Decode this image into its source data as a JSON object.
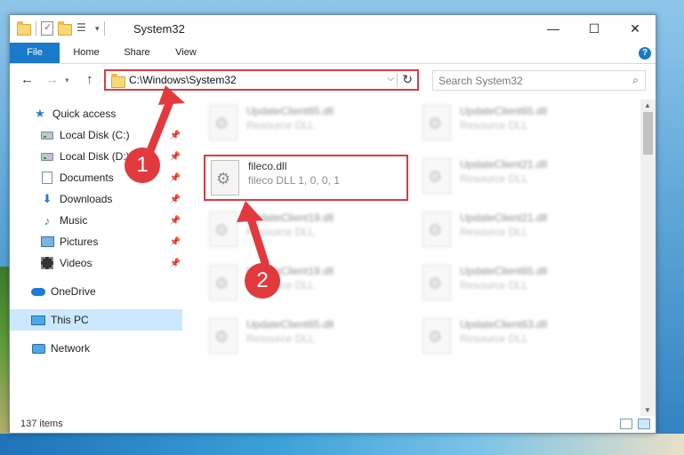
{
  "window": {
    "title": "System32"
  },
  "ribbon": {
    "tabs": [
      "File",
      "Home",
      "Share",
      "View"
    ],
    "help": "?"
  },
  "window_controls": {
    "minimize": "—",
    "maximize": "☐",
    "close": "✕"
  },
  "navigation": {
    "back": "←",
    "forward": "→",
    "recent": "▾",
    "up": "↑",
    "address": "C:\\Windows\\System32",
    "address_dropdown": "⌵",
    "refresh": "↻",
    "search_placeholder": "Search System32",
    "search_icon": "⌕"
  },
  "sidebar": {
    "items": [
      {
        "label": "Quick access",
        "icon": "star-icon",
        "pinned": false
      },
      {
        "label": "Local Disk (C:)",
        "icon": "drive-icon",
        "pinned": true
      },
      {
        "label": "Local Disk (D:)",
        "icon": "drive-icon",
        "pinned": true
      },
      {
        "label": "Documents",
        "icon": "documents-icon",
        "pinned": true
      },
      {
        "label": "Downloads",
        "icon": "download-icon",
        "pinned": true
      },
      {
        "label": "Music",
        "icon": "music-icon",
        "pinned": true
      },
      {
        "label": "Pictures",
        "icon": "pictures-icon",
        "pinned": true
      },
      {
        "label": "Videos",
        "icon": "videos-icon",
        "pinned": true
      },
      {
        "label": "OneDrive",
        "icon": "cloud-icon",
        "pinned": false
      },
      {
        "label": "This PC",
        "icon": "computer-icon",
        "pinned": false,
        "selected": true
      },
      {
        "label": "Network",
        "icon": "network-icon",
        "pinned": false
      }
    ],
    "pin_glyph": "📌"
  },
  "files": [
    {
      "name": "UpdateClient65.dll",
      "desc": "Resource DLL",
      "blurred": true
    },
    {
      "name": "UpdateClient65.dll",
      "desc": "Resource DLL",
      "blurred": true
    },
    {
      "name": "fileco.dll",
      "desc": "fileco DLL 1, 0, 0, 1",
      "blurred": false,
      "highlighted": true
    },
    {
      "name": "UpdateClient21.dll",
      "desc": "Resource DLL",
      "blurred": true
    },
    {
      "name": "UpdateClient19.dll",
      "desc": "Resource DLL",
      "blurred": true
    },
    {
      "name": "UpdateClient21.dll",
      "desc": "Resource DLL",
      "blurred": true
    },
    {
      "name": "UpdateClient19.dll",
      "desc": "Resource DLL",
      "blurred": true
    },
    {
      "name": "UpdateClient65.dll",
      "desc": "Resource DLL",
      "blurred": true
    },
    {
      "name": "UpdateClient65.dll",
      "desc": "Resource DLL",
      "blurred": true
    },
    {
      "name": "UpdateClient63.dll",
      "desc": "Resource DLL",
      "blurred": true
    }
  ],
  "status": {
    "item_count": "137 items"
  },
  "callouts": [
    "1",
    "2"
  ],
  "colors": {
    "accent": "#1979ca",
    "highlight": "#e0393e",
    "selection": "#cce8ff"
  }
}
